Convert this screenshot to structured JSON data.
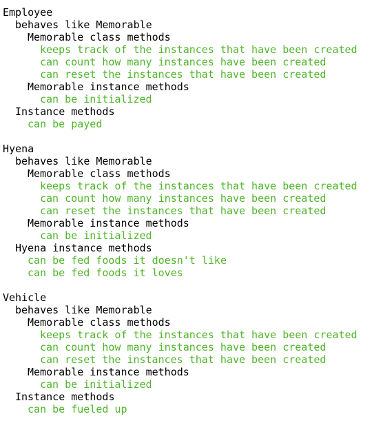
{
  "window": {
    "colors": {
      "background": "#ffffff",
      "group_text": "#000000",
      "pass_text": "#4fb52a"
    }
  },
  "output": {
    "lines": [
      {
        "text": "Employee",
        "indent": 0,
        "kind": "group"
      },
      {
        "text": "behaves like Memorable",
        "indent": 1,
        "kind": "group"
      },
      {
        "text": "Memorable class methods",
        "indent": 2,
        "kind": "group"
      },
      {
        "text": "keeps track of the instances that have been created",
        "indent": 3,
        "kind": "pass"
      },
      {
        "text": "can count how many instances have been created",
        "indent": 3,
        "kind": "pass"
      },
      {
        "text": "can reset the instances that have been created",
        "indent": 3,
        "kind": "pass"
      },
      {
        "text": "Memorable instance methods",
        "indent": 2,
        "kind": "group"
      },
      {
        "text": "can be initialized",
        "indent": 3,
        "kind": "pass"
      },
      {
        "text": "Instance methods",
        "indent": 1,
        "kind": "group"
      },
      {
        "text": "can be payed",
        "indent": 2,
        "kind": "pass"
      },
      {
        "text": "",
        "indent": 0,
        "kind": "blank"
      },
      {
        "text": "Hyena",
        "indent": 0,
        "kind": "group"
      },
      {
        "text": "behaves like Memorable",
        "indent": 1,
        "kind": "group"
      },
      {
        "text": "Memorable class methods",
        "indent": 2,
        "kind": "group"
      },
      {
        "text": "keeps track of the instances that have been created",
        "indent": 3,
        "kind": "pass"
      },
      {
        "text": "can count how many instances have been created",
        "indent": 3,
        "kind": "pass"
      },
      {
        "text": "can reset the instances that have been created",
        "indent": 3,
        "kind": "pass"
      },
      {
        "text": "Memorable instance methods",
        "indent": 2,
        "kind": "group"
      },
      {
        "text": "can be initialized",
        "indent": 3,
        "kind": "pass"
      },
      {
        "text": "Hyena instance methods",
        "indent": 1,
        "kind": "group"
      },
      {
        "text": "can be fed foods it doesn't like",
        "indent": 2,
        "kind": "pass"
      },
      {
        "text": "can be fed foods it loves",
        "indent": 2,
        "kind": "pass"
      },
      {
        "text": "",
        "indent": 0,
        "kind": "blank"
      },
      {
        "text": "Vehicle",
        "indent": 0,
        "kind": "group"
      },
      {
        "text": "behaves like Memorable",
        "indent": 1,
        "kind": "group"
      },
      {
        "text": "Memorable class methods",
        "indent": 2,
        "kind": "group"
      },
      {
        "text": "keeps track of the instances that have been created",
        "indent": 3,
        "kind": "pass"
      },
      {
        "text": "can count how many instances have been created",
        "indent": 3,
        "kind": "pass"
      },
      {
        "text": "can reset the instances that have been created",
        "indent": 3,
        "kind": "pass"
      },
      {
        "text": "Memorable instance methods",
        "indent": 2,
        "kind": "group"
      },
      {
        "text": "can be initialized",
        "indent": 3,
        "kind": "pass"
      },
      {
        "text": "Instance methods",
        "indent": 1,
        "kind": "group"
      },
      {
        "text": "can be fueled up",
        "indent": 2,
        "kind": "pass"
      }
    ]
  }
}
